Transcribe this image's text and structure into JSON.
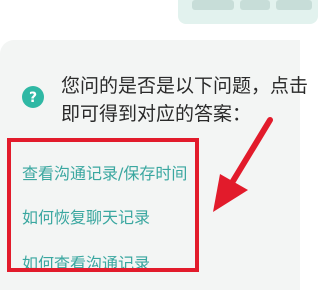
{
  "prompt": {
    "line1": "您问的是否是以下问题，点击",
    "line2": "即可得到对应的答案："
  },
  "questions": [
    {
      "label": "查看沟通记录/保存时间"
    },
    {
      "label": "如何恢复聊天记录"
    },
    {
      "label": "如何查看沟通记录"
    }
  ],
  "icons": {
    "help": "question-mark-icon"
  },
  "colors": {
    "accent": "#2fb8a4",
    "link": "#3aa7a0",
    "annotation": "#e21b2b",
    "card_background": "#f3f5f4"
  }
}
